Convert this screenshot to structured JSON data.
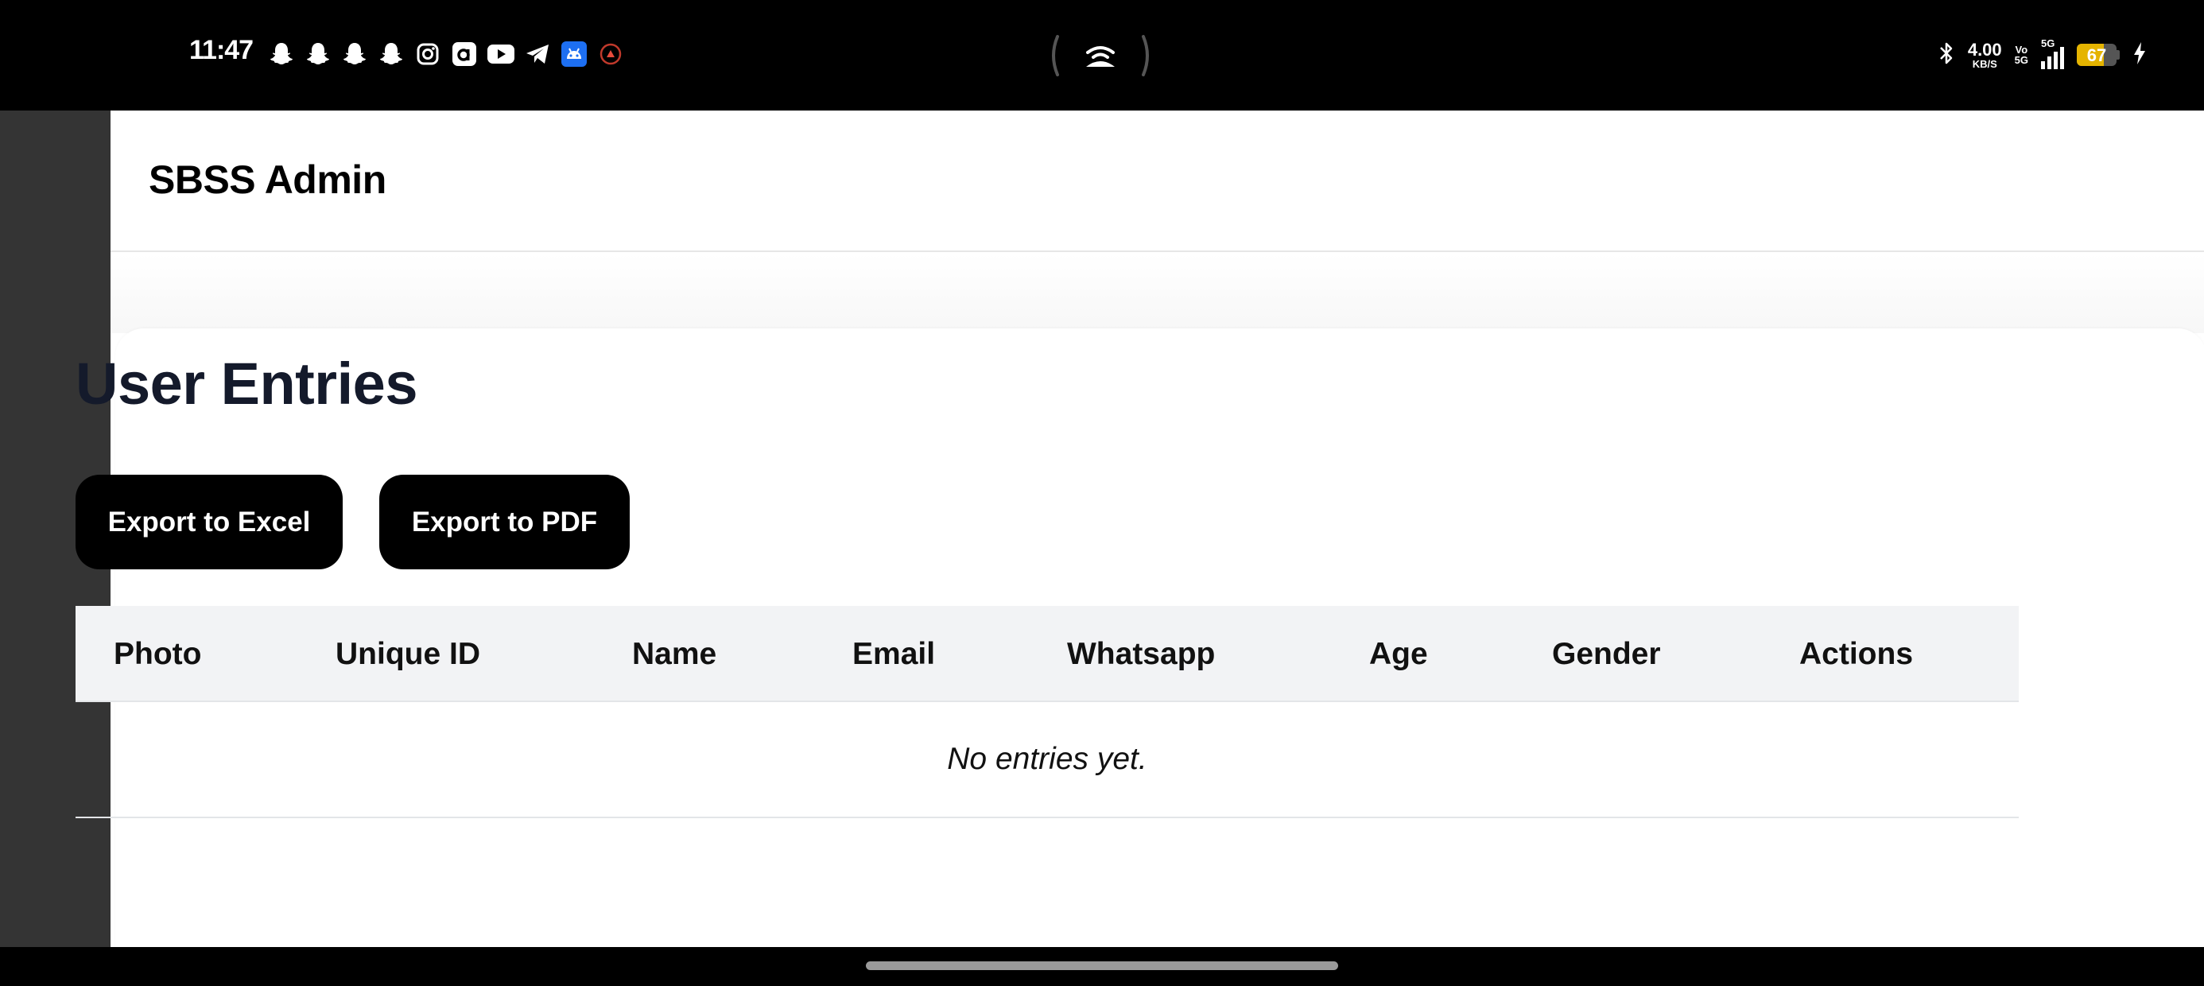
{
  "status_bar": {
    "time": "11:47",
    "notification_icons": [
      "snapchat-icon",
      "snapchat-icon",
      "snapchat-icon",
      "snapchat-icon",
      "instagram-icon",
      "amazon-icon",
      "youtube-icon",
      "telegram-icon",
      "android-icon",
      "app-icon"
    ],
    "center_icon": "hotspot-icon",
    "network_speed": "4.00",
    "network_speed_unit": "KB/S",
    "volte_top": "Vo",
    "volte_bottom": "5G",
    "signal_label": "5G",
    "battery_percent": "67",
    "battery_level": 67,
    "battery_color": "#e5b400",
    "charging": true
  },
  "app": {
    "title": "SBSS Admin"
  },
  "main": {
    "heading": "User Entries",
    "export_excel_label": "Export to Excel",
    "export_pdf_label": "Export to PDF",
    "table": {
      "columns": [
        "Photo",
        "Unique ID",
        "Name",
        "Email",
        "Whatsapp",
        "Age",
        "Gender",
        "Actions"
      ],
      "empty_message": "No entries yet."
    }
  }
}
